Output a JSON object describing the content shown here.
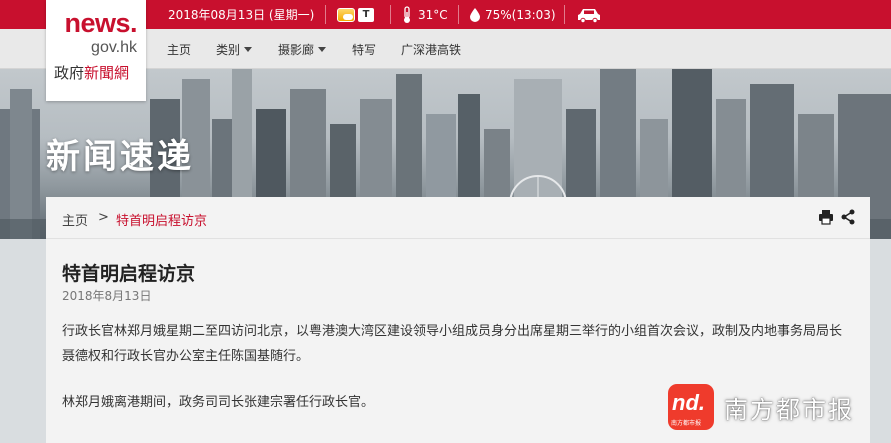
{
  "topbar": {
    "date": "2018年08月13日 (星期一)",
    "weather_icon": "sunny-cloud-icon",
    "t_badge": "T",
    "temperature": "31°C",
    "humidity": "75%(13:03)",
    "traffic_icon": "car-icon",
    "bg_color": "#c8102e"
  },
  "logo": {
    "line1": "news.",
    "line2": "gov.hk",
    "line3_prefix": "政府",
    "line3_highlight": "新聞網"
  },
  "nav": {
    "home": "主页",
    "categories": "类别",
    "gallery": "摄影廊",
    "features": "特写",
    "xrl": "广深港高铁"
  },
  "banner": {
    "title": "新闻速递"
  },
  "breadcrumb": {
    "home": "主页",
    "separator": ">",
    "current": "特首明启程访京"
  },
  "tools": {
    "print_icon": "print-icon",
    "share_icon": "share-icon"
  },
  "article": {
    "title": "特首明启程访京",
    "date": "2018年8月13日",
    "para1": "行政长官林郑月娥星期二至四访问北京，以粤港澳大湾区建设领导小组成员身分出席星期三举行的小组首次会议，政制及内地事务局局长聂德权和行政长官办公室主任陈国基随行。",
    "para2": "林郑月娥离港期间，政务司司长张建宗署任行政长官。"
  },
  "watermark": {
    "logo_text": "nd.",
    "logo_sub": "南方都市报",
    "text": "南方都市报"
  }
}
